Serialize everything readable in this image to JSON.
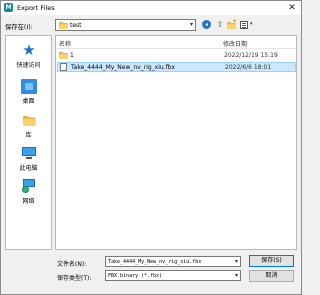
{
  "window": {
    "title": "Export Files",
    "app_icon_letter": "M"
  },
  "save_in": {
    "label": "保存在(I):",
    "value": "test"
  },
  "places": [
    {
      "label": "快速访问",
      "icon": "star-icon"
    },
    {
      "label": "桌面",
      "icon": "desktop-icon"
    },
    {
      "label": "库",
      "icon": "library-icon"
    },
    {
      "label": "此电脑",
      "icon": "computer-icon"
    },
    {
      "label": "网络",
      "icon": "network-icon"
    }
  ],
  "file_list": {
    "columns": {
      "name": "名称",
      "modified": "修改日期"
    },
    "rows": [
      {
        "name": "1",
        "modified": "2022/12/19 15:19",
        "type": "folder"
      },
      {
        "name": "Take_4444_My_New_nv_rig_xiu.fbx",
        "modified": "2022/6/6 18:01",
        "type": "file",
        "selected": true
      }
    ]
  },
  "filename": {
    "label": "文件名(N):",
    "value": "Take_4444_My_New_nv_rig_xiu.fbx"
  },
  "filetype": {
    "label": "保存类型(T):",
    "value": "FBX binary (*.fbx)"
  },
  "buttons": {
    "save": "保存(S)",
    "cancel": "取消"
  },
  "colors": {
    "selection": "#cce8ff",
    "accent": "#0078d7"
  }
}
